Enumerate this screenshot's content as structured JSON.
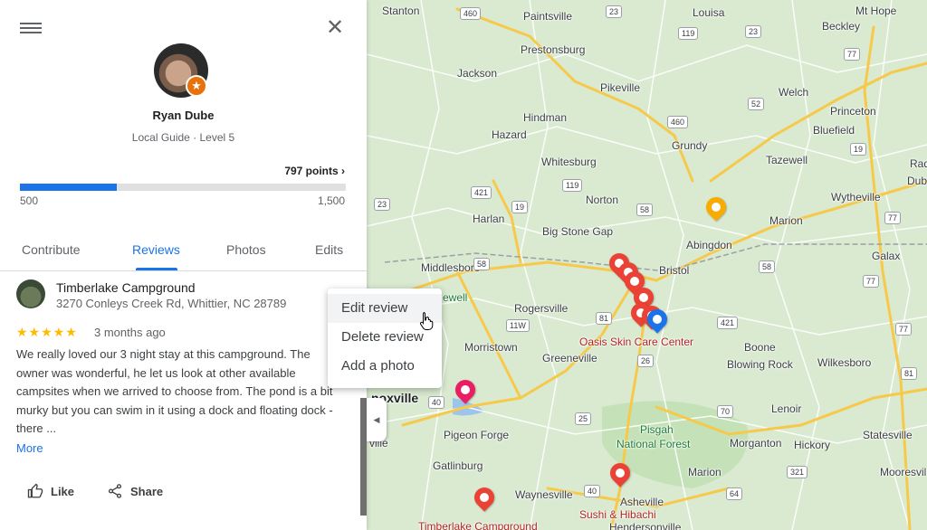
{
  "panel": {
    "menu_icon": "hamburger-menu-icon",
    "close_icon": "close-icon",
    "close_glyph": "✕",
    "profile": {
      "name": "Ryan Dube",
      "level": "Local Guide · Level 5",
      "badge_icon": "star-badge-icon",
      "badge_glyph": "★"
    },
    "points": {
      "label": "797 points ›",
      "min": "500",
      "max": "1,500",
      "progress_fraction": 0.297
    },
    "tabs": [
      {
        "label": "Contribute",
        "active": false
      },
      {
        "label": "Reviews",
        "active": true
      },
      {
        "label": "Photos",
        "active": false
      },
      {
        "label": "Edits",
        "active": false
      }
    ],
    "review": {
      "place_name": "Timberlake Campground",
      "address": "3270 Conleys Creek Rd, Whittier, NC 28789",
      "stars": "★★★★★",
      "rating": 5,
      "time": "3 months ago",
      "text": "We really loved our 3 night stay at this campground. The owner was wonderful,  he let us look at other available campsites when we arrived to choose from. The pond is a bit murky but you can swim in it using a dock and floating dock - there ...",
      "more": "More",
      "like": "Like",
      "share": "Share"
    },
    "collapse_glyph": "◀"
  },
  "context_menu": {
    "items": [
      "Edit review",
      "Delete review",
      "Add a photo"
    ],
    "hovered": "Edit review"
  },
  "map": {
    "labels": {
      "stanton": "Stanton",
      "paintsville": "Paintsville",
      "louisa": "Louisa",
      "mthope": "Mt Hope",
      "beckley": "Beckley",
      "prestonsburg": "Prestonsburg",
      "jackson": "Jackson",
      "pikeville": "Pikeville",
      "welch": "Welch",
      "princeton": "Princeton",
      "hindman": "Hindman",
      "bluefield": "Bluefield",
      "hazard": "Hazard",
      "grundy": "Grundy",
      "tazewell": "Tazewell",
      "whitesburg": "Whitesburg",
      "radford": "Rad",
      "wytheville": "Wytheville",
      "dub": "Dub",
      "norton": "Norton",
      "harlan": "Harlan",
      "marion1": "Marion",
      "bigstonegap": "Big Stone Gap",
      "abingdon": "Abingdon",
      "galax": "Galax",
      "middlesboro": "Middlesboro",
      "bristol": "Bristol",
      "ewell": "ewell",
      "rogersville": "Rogersville",
      "morristown": "Morristown",
      "greeneville": "Greeneville",
      "oasis": "Oasis Skin Care Center",
      "boone": "Boone",
      "blowingrock": "Blowing Rock",
      "wilkesboro": "Wilkesboro",
      "knoxville": "noxville",
      "lenoir": "Lenoir",
      "statesville": "Statesville",
      "pigeonforge": "Pigeon Forge",
      "pisgah": "Pisgah",
      "nationalforest": "National Forest",
      "morganton": "Morganton",
      "hickory": "Hickory",
      "gatlinburg": "Gatlinburg",
      "marion2": "Marion",
      "mooresville": "Mooresvill",
      "waynesville": "Waynesville",
      "asheville": "Asheville",
      "sushi": "Sushi & Hibachi",
      "timberlake": "Timberlake Campground",
      "hendersonville": "Hendersonville",
      "ville": "ville"
    },
    "shields": [
      "460",
      "23",
      "119",
      "23",
      "52",
      "77",
      "460",
      "19",
      "421",
      "119",
      "23",
      "58",
      "19",
      "77",
      "58",
      "58",
      "11W",
      "81",
      "421",
      "26",
      "40",
      "25",
      "70",
      "321",
      "64",
      "40",
      "77",
      "81",
      "77"
    ]
  }
}
